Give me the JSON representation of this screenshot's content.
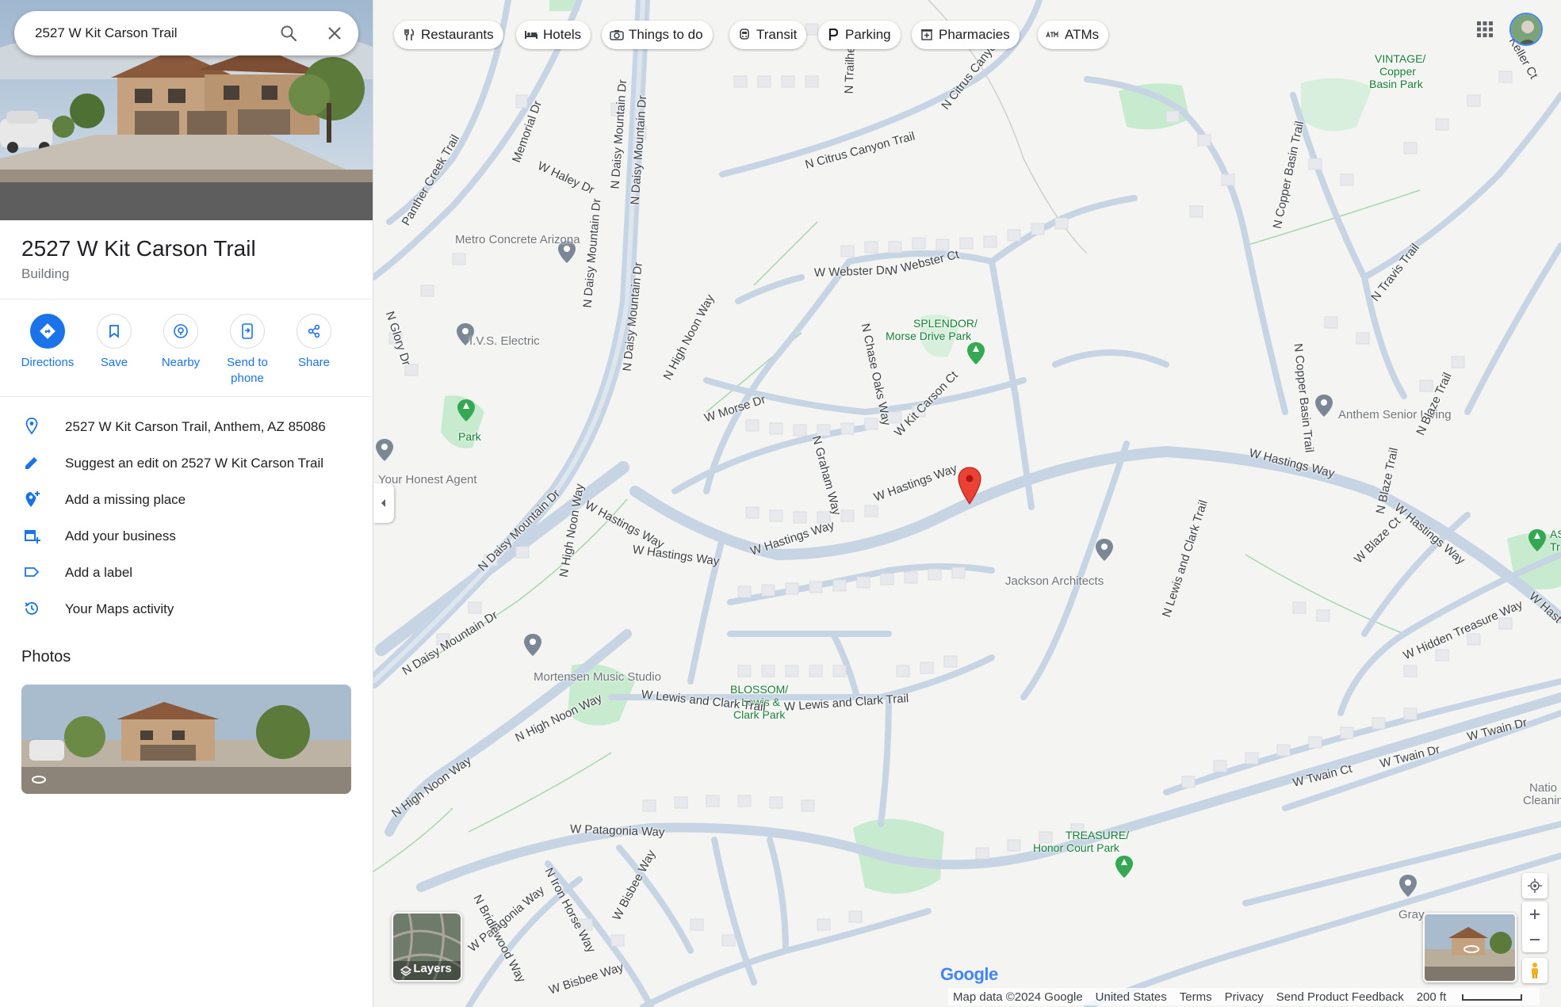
{
  "search": {
    "value": "2527 W Kit Carson Trail"
  },
  "place": {
    "title": "2527 W Kit Carson Trail",
    "subtitle": "Building"
  },
  "actions": [
    {
      "label": "Directions"
    },
    {
      "label": "Save"
    },
    {
      "label": "Nearby"
    },
    {
      "label": "Send to phone"
    },
    {
      "label": "Share"
    }
  ],
  "info": {
    "address": "2527 W Kit Carson Trail, Anthem, AZ 85086",
    "suggest_edit": "Suggest an edit on 2527 W Kit Carson Trail",
    "add_missing_place": "Add a missing place",
    "add_business": "Add your business",
    "add_label": "Add a label",
    "maps_activity": "Your Maps activity"
  },
  "photos": {
    "heading": "Photos"
  },
  "chips": [
    "Restaurants",
    "Hotels",
    "Things to do",
    "Transit",
    "Parking",
    "Pharmacies",
    "ATMs"
  ],
  "map": {
    "layers_label": "Layers",
    "google_logo": "Google",
    "footer": {
      "map_data": "Map data ©2024 Google",
      "country": "United States",
      "terms": "Terms",
      "privacy": "Privacy",
      "feedback": "Send Product Feedback",
      "scale": "200 ft"
    },
    "places": {
      "metro_concrete": "Metro Concrete Arizona",
      "ivs_electric": "I.V.S. Electric",
      "park": "Park",
      "honest_agent": "Your Honest Agent",
      "splendor_1": "SPLENDOR/",
      "splendor_2": "Morse Drive Park",
      "vintage_1": "VINTAGE/",
      "vintage_2": "Copper",
      "vintage_3": "Basin Park",
      "anthem_senior": "Anthem Senior Living",
      "jackson": "Jackson Architects",
      "mortensen": "Mortensen Music Studio",
      "blossom_1": "BLOSSOM/",
      "blossom_2": "Lewis &",
      "blossom_3": "Clark Park",
      "treasure_1": "TREASURE/",
      "treasure_2": "Honor Court Park",
      "natio_1": "Natio",
      "natio_2": "Cleanin",
      "gray": "Gray",
      "as_1": "AS",
      "as_2": "Tr"
    },
    "roads": {
      "citrus_canyon": "N Citrus Canyon Trail",
      "citrus_canyon_2": "N Citrus Canyo",
      "trailhead": "N Trailhead",
      "memorial": "Memorial Dr",
      "panther": "Panther Creek Trail",
      "haley": "W Haley Dr",
      "glory": "N Glory Dr",
      "daisy_1": "N Daisy Mountain Dr",
      "daisy_2": "N Daisy Mountain Dr",
      "daisy_3": "N Daisy Mountain Dr",
      "daisy_4": "N Daisy Mountain Dr",
      "daisy_5": "N Daisy Mountain Dr",
      "daisy_6": "N Daisy Mountain Dr",
      "webster_dr": "W Webster Dr",
      "webster_ct": "W Webster Ct",
      "high_noon_1": "N High Noon Way",
      "high_noon_2": "N High Noon Way",
      "high_noon_3": "N High Noon Way",
      "high_noon_4": "N High Noon Way",
      "chase_oaks": "N Chase Oaks Way",
      "morse": "W Morse Dr",
      "graham": "N Graham Way",
      "kit_carson_ct": "W Kit Carson Ct",
      "hastings_1": "W Hastings Way",
      "hastings_2": "W Hastings Way",
      "hastings_3": "W Hastings Way",
      "hastings_4": "W Hastings Way",
      "hastings_5": "W Hastings Way",
      "hastings_6": "W Hastings Way",
      "hastings_7": "W Hast",
      "copper_basin_1": "N Copper Basin Trail",
      "copper_basin_2": "N Copper Basin Trail",
      "travis": "N Travis Trail",
      "blaze_1": "N Blaze Trail",
      "blaze_2": "N Blaze Trail",
      "blaze_ct": "W Blaze Ct",
      "lewis_clark_1": "N Lewis and Clark Trail",
      "lewis_clark_2": "W Lewis and Clark Trail",
      "lewis_clark_3": "W Lewis and Clark Trail",
      "hidden_treasure": "W Hidden Treasure Way",
      "twain_dr_1": "W Twain Dr",
      "twain_dr_2": "W Twain Dr",
      "twain_ct": "W Twain Ct",
      "patagonia_1": "W Patagonia Way",
      "patagonia_2": "W Patagonia Way",
      "iron_horse": "N Iron Horse Way",
      "bridlewood": "N Bridlewood Way",
      "bisbee_1": "W Bisbee Way",
      "bisbee_2": "W Bisbee Way",
      "keller": "Keller Ct"
    }
  },
  "colors": {
    "accent": "#1a73e8",
    "pin": "#ea4335",
    "park": "#c8ebcf",
    "road": "#c6d4e4",
    "map_bg": "#f4f4f2"
  }
}
